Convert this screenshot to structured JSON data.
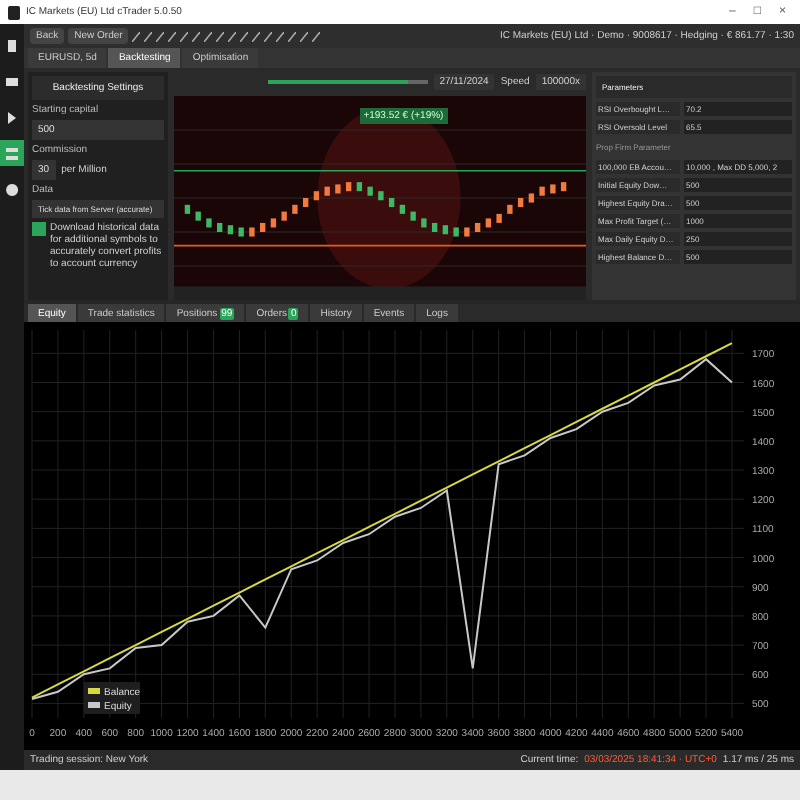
{
  "window": {
    "title": "IC Markets (EU) Ltd cTrader 5.0.50",
    "controls": [
      "–",
      "□",
      "×"
    ]
  },
  "sidebar": {
    "items": [
      {
        "selected": false
      },
      {
        "selected": false
      },
      {
        "selected": false
      },
      {
        "selected": true
      },
      {
        "selected": false
      }
    ]
  },
  "toolbar": {
    "buttons": [
      "Back",
      "New Order"
    ],
    "account": "IC Markets (EU) Ltd · Demo · 9008617 · Hedging · € 861.77 · 1:30"
  },
  "tabs": [
    {
      "label": "EURUSD, 5d",
      "selected": false
    },
    {
      "label": "Backtesting",
      "selected": true
    },
    {
      "label": "Optimisation",
      "selected": false
    }
  ],
  "backtesting_settings": {
    "title": "Backtesting Settings",
    "starting_capital": {
      "label": "Starting capital",
      "value": "500"
    },
    "commission": {
      "label": "Commission",
      "value": "30",
      "unit": "per Million"
    },
    "data": {
      "label": "Data",
      "value": "Tick data from Server (accurate)"
    },
    "download": {
      "checked": true,
      "label": "Download historical data for additional symbols to accurately convert profits to account currency"
    }
  },
  "playback": {
    "level": 0.88,
    "date": "27/11/2024",
    "speed_label": "Speed",
    "speed": "100000x"
  },
  "price_chart": {
    "badge": "+193.52 € (+19%)"
  },
  "parameters": {
    "title": "Parameters",
    "rows": [
      {
        "label": "RSI Overbought L…",
        "value": "70.2"
      },
      {
        "label": "RSI Oversold Level",
        "value": "65.5"
      }
    ],
    "section": "Prop Firm Parameter",
    "prop_rows": [
      {
        "label": "100,000 EB Accou…",
        "value": "10,000 , Max DD 5,000, 2"
      },
      {
        "label": "Initial Equity Dow…",
        "value": "500"
      },
      {
        "label": "Highest Equity Dra…",
        "value": "500"
      },
      {
        "label": "Max Profit Target (…",
        "value": "1000"
      },
      {
        "label": "Max Daily Equity D…",
        "value": "250"
      },
      {
        "label": "Highest Balance D…",
        "value": "500"
      }
    ]
  },
  "bottom_tabs": [
    {
      "label": "Equity",
      "selected": true
    },
    {
      "label": "Trade statistics",
      "selected": false
    },
    {
      "label": "Positions",
      "badge": "99",
      "selected": false
    },
    {
      "label": "Orders",
      "badge": "0",
      "selected": false
    },
    {
      "label": "History",
      "selected": false
    },
    {
      "label": "Events",
      "selected": false
    },
    {
      "label": "Logs",
      "selected": false
    }
  ],
  "equity": {
    "chart_data": {
      "type": "line",
      "xlim": [
        0,
        5400
      ],
      "grid": true,
      "legend": true,
      "x": [
        0,
        200,
        400,
        600,
        800,
        1000,
        1200,
        1400,
        1600,
        1800,
        2000,
        2200,
        2400,
        2600,
        2800,
        3000,
        3200,
        3400,
        3600,
        3800,
        4000,
        4200,
        4400,
        4600,
        4800,
        5000,
        5200,
        5400
      ],
      "xticks": [
        0,
        200,
        400,
        600,
        800,
        1000,
        1200,
        1400,
        1600,
        1800,
        2000,
        2200,
        2400,
        2600,
        2800,
        3000,
        3200,
        3400,
        3600,
        3800,
        4000,
        4200,
        4400,
        4600,
        4800,
        5000,
        5200,
        5400
      ],
      "yticks": [
        500,
        600,
        700,
        800,
        900,
        1000,
        1100,
        1200,
        1300,
        1400,
        1500,
        1600,
        1700
      ],
      "ylim": [
        450,
        1780
      ],
      "series": [
        {
          "name": "Balance",
          "color": "#d8d840",
          "values": [
            520,
            565,
            610,
            655,
            700,
            745,
            790,
            835,
            880,
            925,
            970,
            1015,
            1060,
            1105,
            1150,
            1195,
            1240,
            1285,
            1330,
            1375,
            1420,
            1465,
            1510,
            1555,
            1600,
            1645,
            1690,
            1735
          ]
        },
        {
          "name": "Equity",
          "color": "#c8c8c8",
          "values": [
            515,
            540,
            600,
            620,
            690,
            700,
            780,
            800,
            870,
            760,
            960,
            990,
            1050,
            1080,
            1140,
            1170,
            1230,
            620,
            1320,
            1350,
            1410,
            1440,
            1500,
            1530,
            1590,
            1610,
            1680,
            1600
          ]
        }
      ]
    }
  },
  "status_bar": {
    "session": "Trading session: New York",
    "time_label": "Current time:",
    "time": "03/03/2025 18:41:34 · UTC+0",
    "latency": "1.17 ms / 25 ms"
  }
}
